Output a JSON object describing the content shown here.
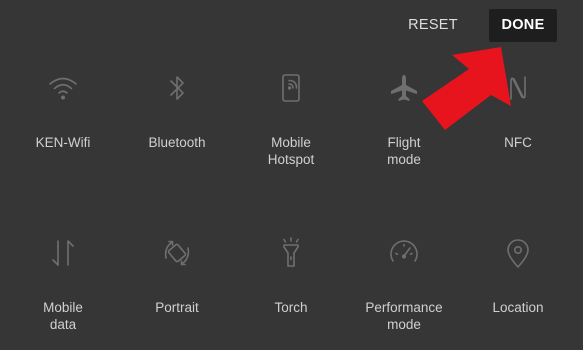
{
  "header": {
    "reset_label": "RESET",
    "done_label": "DONE"
  },
  "tiles": [
    {
      "label": "KEN-Wifi",
      "icon": "wifi-icon"
    },
    {
      "label": "Bluetooth",
      "icon": "bluetooth-icon"
    },
    {
      "label": "Mobile\nHotspot",
      "icon": "hotspot-icon"
    },
    {
      "label": "Flight\nmode",
      "icon": "airplane-icon"
    },
    {
      "label": "NFC",
      "icon": "nfc-icon"
    },
    {
      "label": "Mobile\ndata",
      "icon": "mobile-data-icon"
    },
    {
      "label": "Portrait",
      "icon": "rotate-icon"
    },
    {
      "label": "Torch",
      "icon": "flashlight-icon"
    },
    {
      "label": "Performance\nmode",
      "icon": "speedometer-icon"
    },
    {
      "label": "Location",
      "icon": "location-pin-icon"
    }
  ],
  "colors": {
    "background": "#363636",
    "done_button_bg": "#1e1e1e",
    "icon": "#6f6f6f",
    "label": "#d0d0d0",
    "annotation_arrow": "#e8141d"
  }
}
